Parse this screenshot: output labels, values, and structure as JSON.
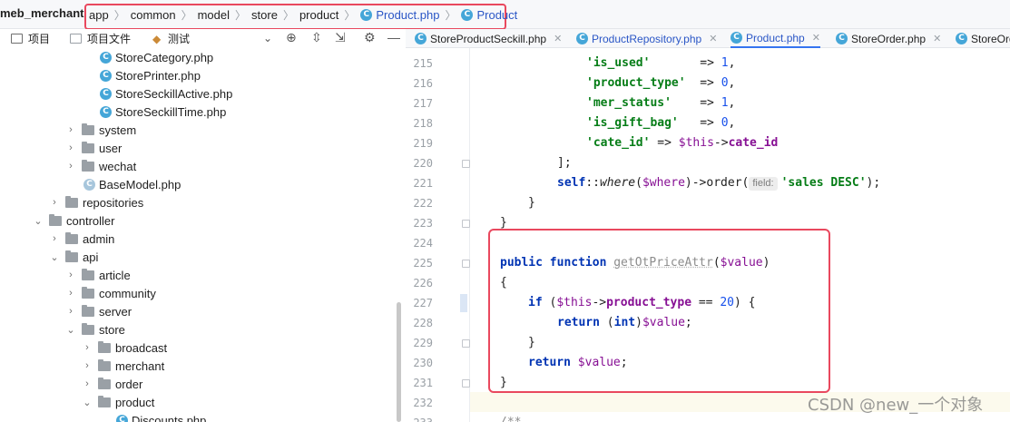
{
  "project_name": "meb_merchant",
  "breadcrumb": [
    "app",
    "common",
    "model",
    "store",
    "product",
    "Product.php",
    "Product"
  ],
  "left_toolbar": {
    "project_label": "项目",
    "project_files_label": "项目文件",
    "tests_label": "测试"
  },
  "tree": [
    {
      "label": "StoreCategory.php",
      "type": "file"
    },
    {
      "label": "StorePrinter.php",
      "type": "file"
    },
    {
      "label": "StoreSeckillActive.php",
      "type": "file"
    },
    {
      "label": "StoreSeckillTime.php",
      "type": "file"
    },
    {
      "label": "system",
      "type": "folder"
    },
    {
      "label": "user",
      "type": "folder"
    },
    {
      "label": "wechat",
      "type": "folder"
    },
    {
      "label": "BaseModel.php",
      "type": "file"
    },
    {
      "label": "repositories",
      "type": "folder"
    },
    {
      "label": "controller",
      "type": "folder"
    },
    {
      "label": "admin",
      "type": "folder"
    },
    {
      "label": "api",
      "type": "folder"
    },
    {
      "label": "article",
      "type": "folder"
    },
    {
      "label": "community",
      "type": "folder"
    },
    {
      "label": "server",
      "type": "folder"
    },
    {
      "label": "store",
      "type": "folder"
    },
    {
      "label": "broadcast",
      "type": "folder"
    },
    {
      "label": "merchant",
      "type": "folder"
    },
    {
      "label": "order",
      "type": "folder"
    },
    {
      "label": "product",
      "type": "folder"
    },
    {
      "label": "Discounts.php",
      "type": "file"
    }
  ],
  "tabs": [
    {
      "label": "StoreProductSeckill.php",
      "active": false
    },
    {
      "label": "ProductRepository.php",
      "active": false
    },
    {
      "label": "Product.php",
      "active": true
    },
    {
      "label": "StoreOrder.php",
      "active": false
    },
    {
      "label": "StoreOrd",
      "active": false
    }
  ],
  "line_numbers": [
    "215",
    "216",
    "217",
    "218",
    "219",
    "220",
    "221",
    "222",
    "223",
    "224",
    "225",
    "226",
    "227",
    "228",
    "229",
    "230",
    "231",
    "232",
    "233"
  ],
  "code": {
    "l215_key": "'is_used'",
    "l215_rest": "       => ",
    "l215_val": "1",
    "l216_key": "'product_type'",
    "l216_rest": "  => ",
    "l216_val": "0",
    "l217_key": "'mer_status'",
    "l217_rest": "    => ",
    "l217_val": "1",
    "l218_key": "'is_gift_bag'",
    "l218_rest": "   => ",
    "l218_val": "0",
    "l219_key": "'cate_id'",
    "l219_arrow": " => ",
    "l219_this": "$this",
    "l219_op": "->",
    "l219_prop": "cate_id",
    "l220": "];",
    "l221_self": "self",
    "l221_colons": "::",
    "l221_where": "where",
    "l221_open": "(",
    "l221_var": "$where",
    "l221_mid": ")->order(",
    "l221_hint": "field:",
    "l221_str": "'sales DESC'",
    "l221_end": ");",
    "l222": "}",
    "l223": "}",
    "l225_kw": "public function ",
    "l225_fn": "getOtPriceAttr",
    "l225_open": "(",
    "l225_var": "$value",
    "l225_close": ")",
    "l226": "{",
    "l227_if": "if",
    "l227_open": " (",
    "l227_this": "$this",
    "l227_op": "->",
    "l227_prop": "product_type",
    "l227_eq": " == ",
    "l227_num": "20",
    "l227_end": ") {",
    "l228_ret": "return",
    "l228_cast_open": " (",
    "l228_int": "int",
    "l228_cast_close": ")",
    "l228_var": "$value",
    "l228_end": ";",
    "l229": "}",
    "l230_ret": "return",
    "l230_var": " $value",
    "l230_end": ";",
    "l231": "}",
    "l233": "/**"
  },
  "watermark": "CSDN @new_一个对象"
}
